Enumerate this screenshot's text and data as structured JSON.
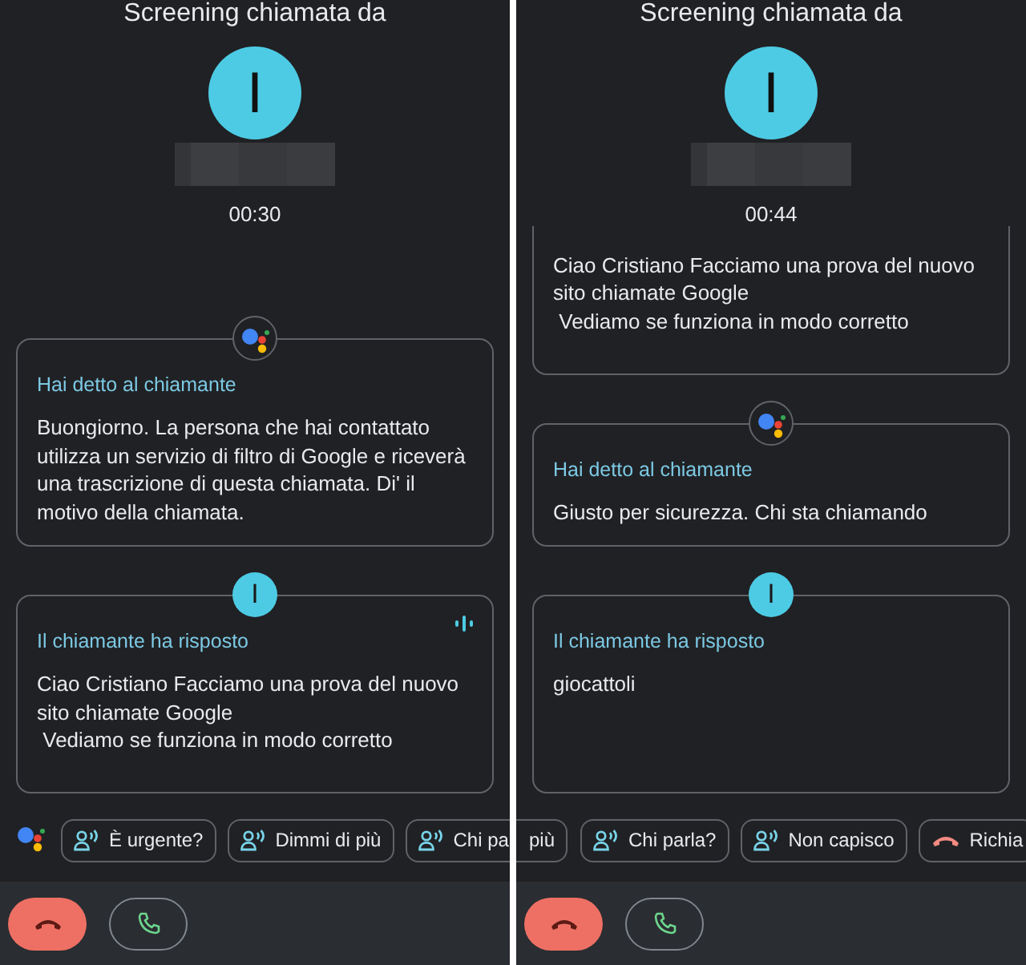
{
  "screens": [
    {
      "title": "Screening chiamata da",
      "avatar_initial": "I",
      "timer": "00:30",
      "messages": [
        {
          "kind": "assistant",
          "badge": true,
          "label": "Hai detto al chiamante",
          "text": "Buongiorno. La persona che hai contattato utilizza un servizio di filtro di Google e riceverà una trascrizione di questa chiamata. Di' il motivo della chiamata.",
          "listening": false
        },
        {
          "kind": "caller",
          "badge": true,
          "initial": "I",
          "label": "Il chiamante ha risposto",
          "text": "Ciao Cristiano Facciamo una prova del nuovo sito chiamate Google\n Vediamo se funziona in modo corretto",
          "listening": true
        }
      ],
      "chips": [
        {
          "kind": "assistant"
        },
        {
          "kind": "speak",
          "label": "È urgente?"
        },
        {
          "kind": "speak",
          "label": "Dimmi di più"
        },
        {
          "kind": "speak",
          "label": "Chi pa"
        }
      ]
    },
    {
      "title": "Screening chiamata da",
      "avatar_initial": "I",
      "timer": "00:44",
      "messages": [
        {
          "kind": "caller",
          "badge": false,
          "text": "Ciao Cristiano Facciamo una prova del nuovo sito chiamate Google\n Vediamo se funziona in modo corretto",
          "listening": false
        },
        {
          "kind": "assistant",
          "badge": true,
          "label": "Hai detto al chiamante",
          "text": "Giusto per sicurezza. Chi sta chiamando",
          "listening": false
        },
        {
          "kind": "caller",
          "badge": true,
          "initial": "I",
          "label": "Il chiamante ha risposto",
          "text": "giocattoli",
          "listening": false
        }
      ],
      "chips": [
        {
          "kind": "partial",
          "label": "più"
        },
        {
          "kind": "speak",
          "label": "Chi parla?"
        },
        {
          "kind": "speak",
          "label": "Non capisco"
        },
        {
          "kind": "hangup",
          "label": "Richia"
        }
      ]
    }
  ]
}
